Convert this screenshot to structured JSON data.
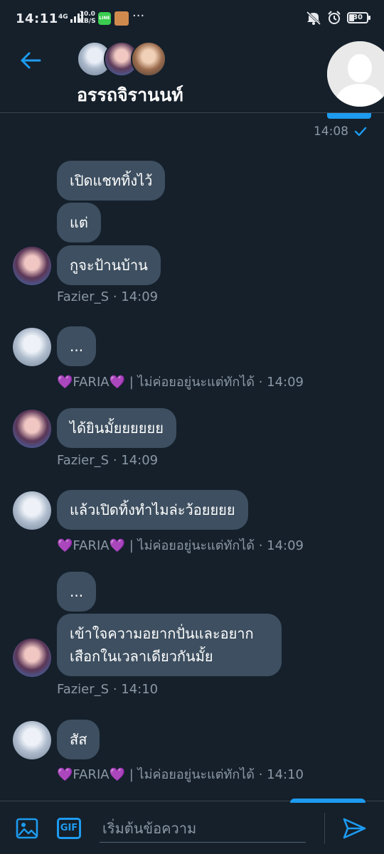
{
  "status": {
    "time": "14:11",
    "network": "4G",
    "speed_top": "10.0",
    "speed_bottom": "KB/S",
    "line_app": "LINE",
    "more": "···",
    "battery": "30"
  },
  "header": {
    "title": "อรรถจิรานนท์"
  },
  "own": {
    "time": "14:08"
  },
  "messages": [
    {
      "text": "เปิดแชททิ้งไว้"
    },
    {
      "text": "แต่"
    },
    {
      "text": "กูจะป้านบ้าน"
    },
    {
      "text": "..."
    },
    {
      "text": "ได้ยินมั้ยยยยยย"
    },
    {
      "text": "แล้วเปิดทิ้งทำไมล่ะว้อยยยย"
    },
    {
      "text": "..."
    },
    {
      "text": "เข้าใจความอยากปั่นและอยากเสือกในเวลาเดียวกันมั้ย"
    },
    {
      "text": "สัส"
    }
  ],
  "meta": {
    "m1": {
      "name": "Fazier_S",
      "time": "14:09"
    },
    "m2": {
      "heart_l": "💜",
      "name": "FARIA",
      "heart_r": "💜",
      "status": "| ไม่ค่อยอยู่นะแต่ทักได้",
      "time": "14:09"
    },
    "m3": {
      "name": "Fazier_S",
      "time": "14:09"
    },
    "m4": {
      "heart_l": "💜",
      "name": "FARIA",
      "heart_r": "💜",
      "status": "| ไม่ค่อยอยู่นะแต่ทักได้",
      "time": "14:09"
    },
    "m5": {
      "name": "Fazier_S",
      "time": "14:10"
    },
    "m6": {
      "heart_l": "💜",
      "name": "FARIA",
      "heart_r": "💜",
      "status": "| ไม่ค่อยอยู่นะแต่ทักได้",
      "time": "14:10"
    }
  },
  "composer": {
    "placeholder": "เริ่มต้นข้อความ",
    "gif": "GIF"
  },
  "colors": {
    "background": "#15202b",
    "bubble": "#3d4f60",
    "accent": "#1d9bf0",
    "muted": "#8b98a5"
  }
}
